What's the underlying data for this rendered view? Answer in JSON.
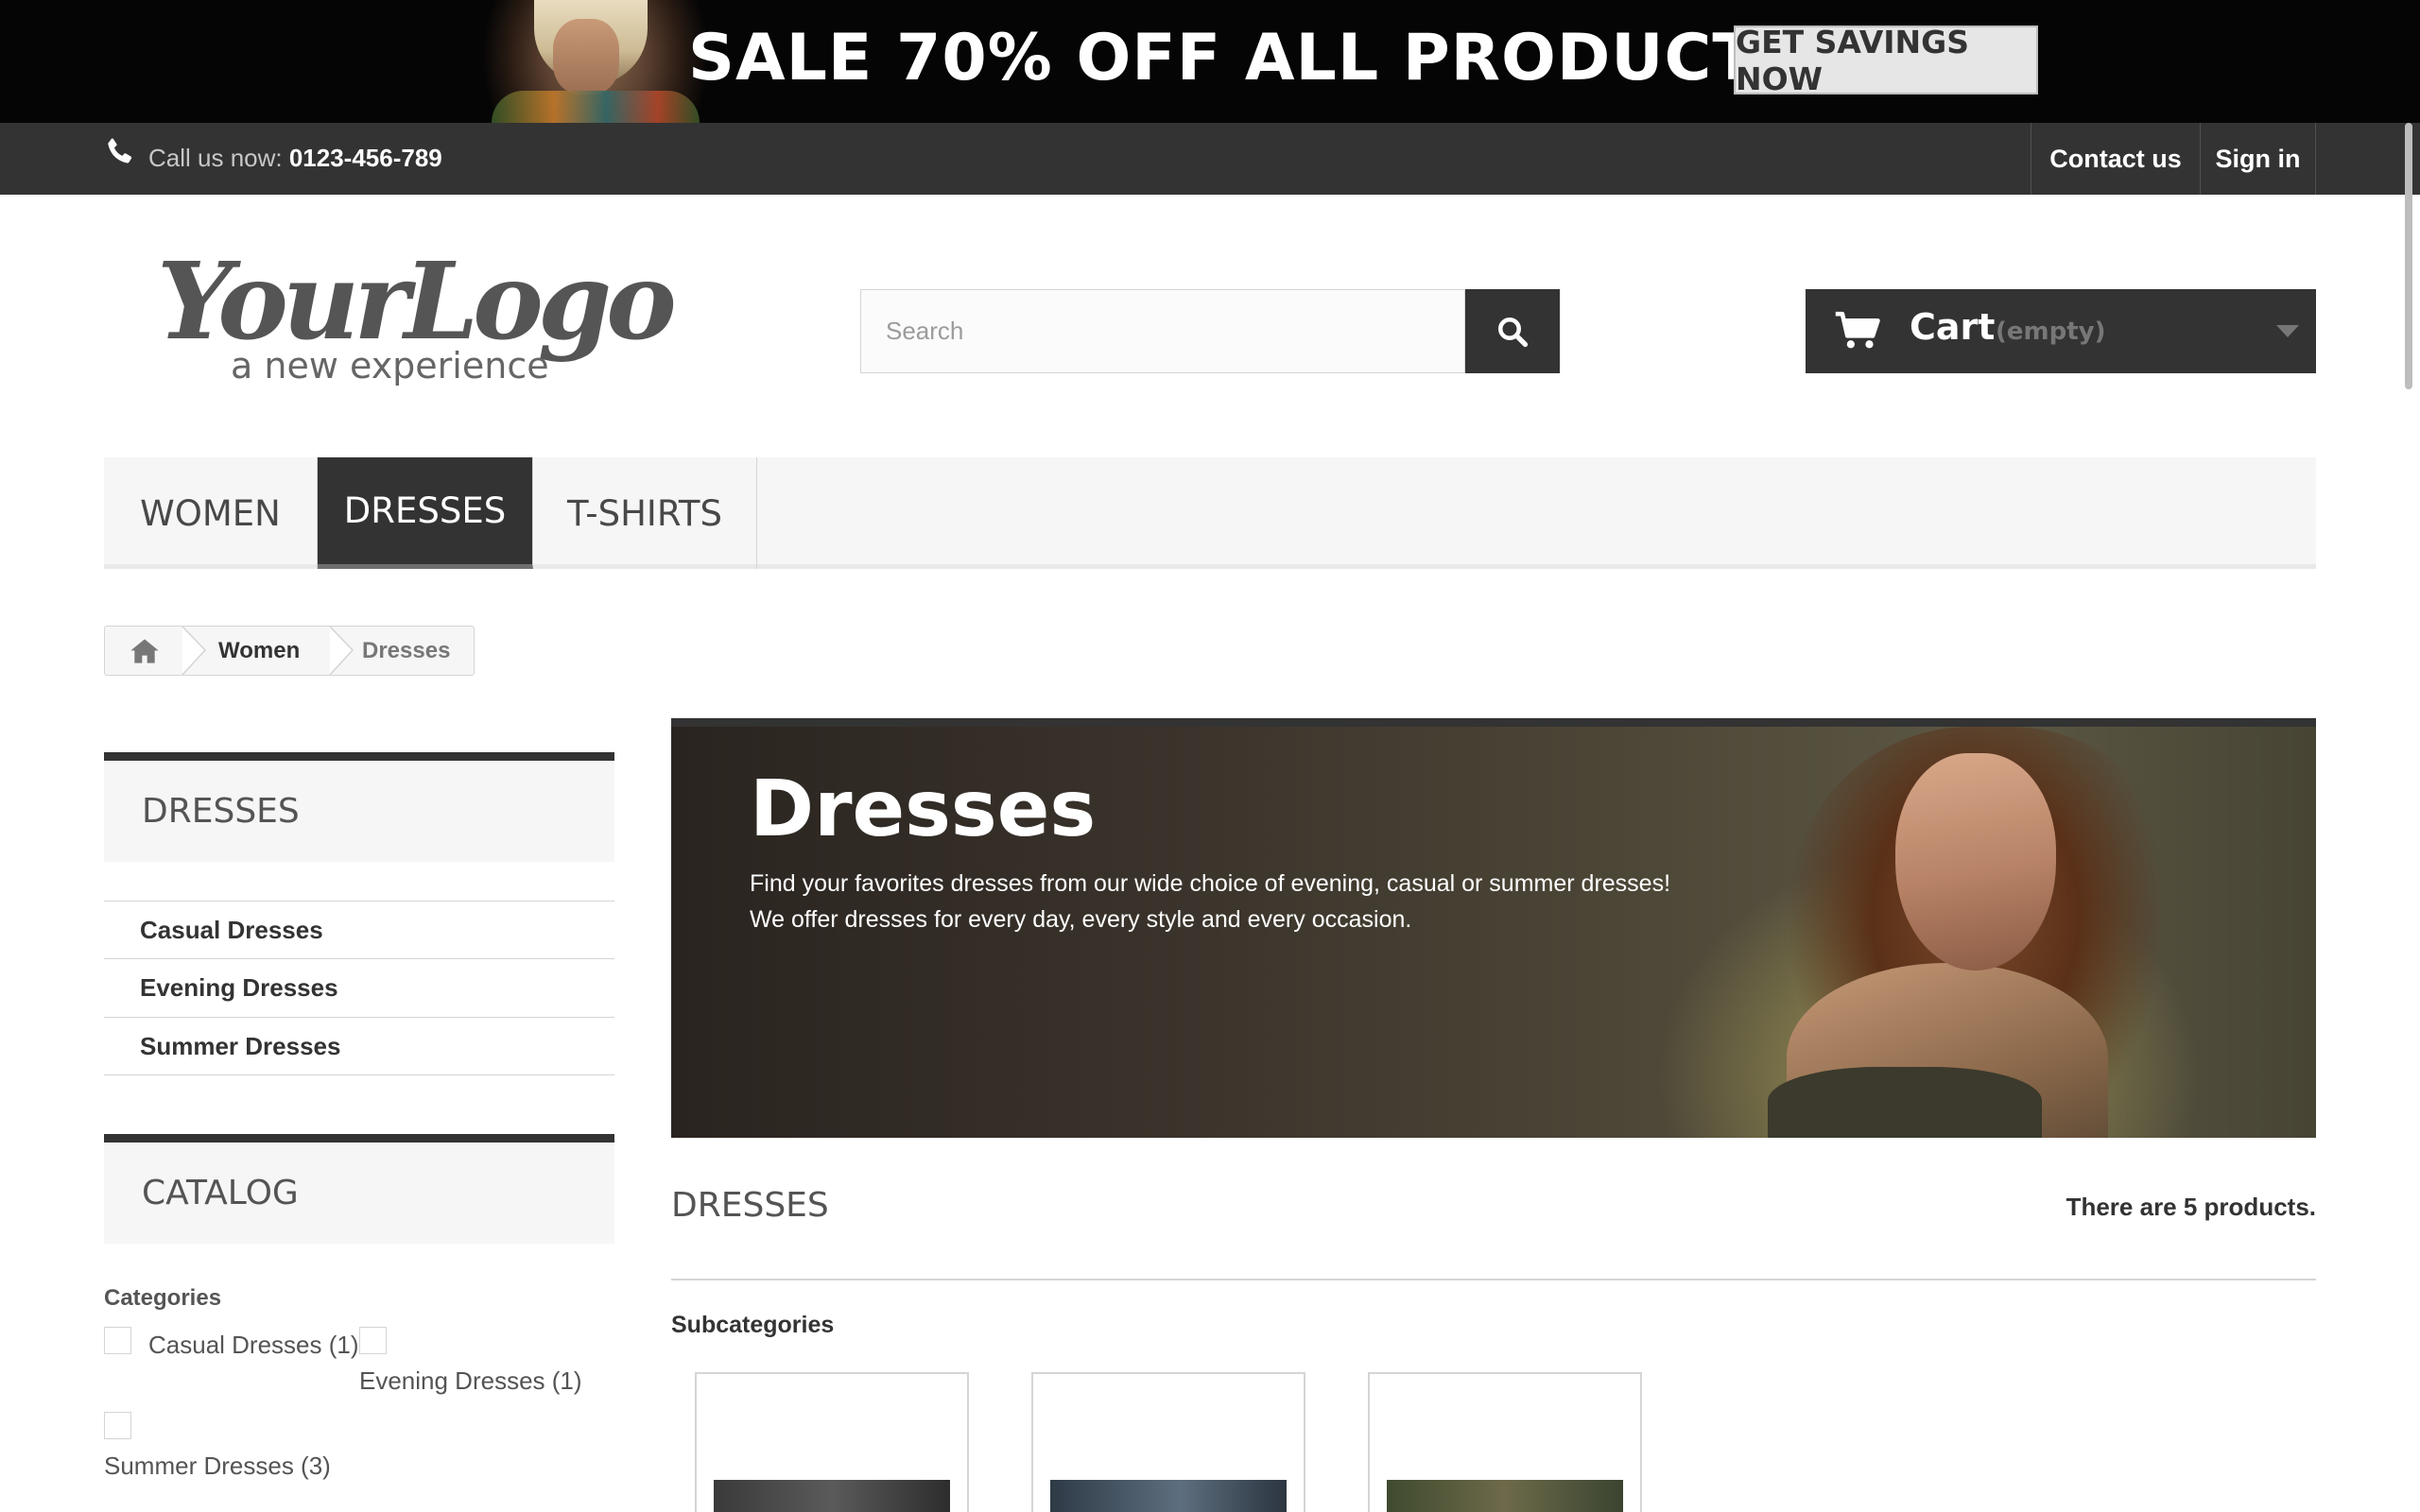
{
  "promo": {
    "headline": "SALE 70% OFF ALL PRODUCTS",
    "button_label": "GET SAVINGS NOW"
  },
  "topbar": {
    "call_label": "Call us now: ",
    "phone": "0123-456-789",
    "contact_label": "Contact us",
    "signin_label": "Sign in"
  },
  "header": {
    "logo_text": "YourLogo",
    "logo_tagline": "a new experience",
    "search_placeholder": "Search",
    "cart_label": "Cart",
    "cart_status": "(empty)"
  },
  "menu": {
    "items": [
      {
        "label": "WOMEN",
        "active": false
      },
      {
        "label": "DRESSES",
        "active": true
      },
      {
        "label": "T-SHIRTS",
        "active": false
      }
    ]
  },
  "breadcrumb": {
    "items": [
      "Women",
      "Dresses"
    ]
  },
  "sidebar": {
    "block1_title": "DRESSES",
    "links": [
      "Casual Dresses",
      "Evening Dresses",
      "Summer Dresses"
    ],
    "block2_title": "CATALOG",
    "filter_group_label": "Categories",
    "filters": [
      "Casual Dresses (1)",
      "Evening Dresses (1)",
      "Summer Dresses (3)"
    ]
  },
  "hero": {
    "title": "Dresses",
    "line1": "Find your favorites dresses from our wide choice of evening, casual or summer dresses!",
    "line2": "We offer dresses for every day, every style and every occasion."
  },
  "category": {
    "heading": "DRESSES",
    "product_count": "There are 5 products.",
    "subcategories_title": "Subcategories"
  },
  "colors": {
    "dark": "#333333",
    "menu_bg": "#f6f6f6",
    "border": "#d6d4d4"
  },
  "icons": [
    "phone-icon",
    "search-icon",
    "cart-icon",
    "chevron-down-icon",
    "home-icon"
  ]
}
